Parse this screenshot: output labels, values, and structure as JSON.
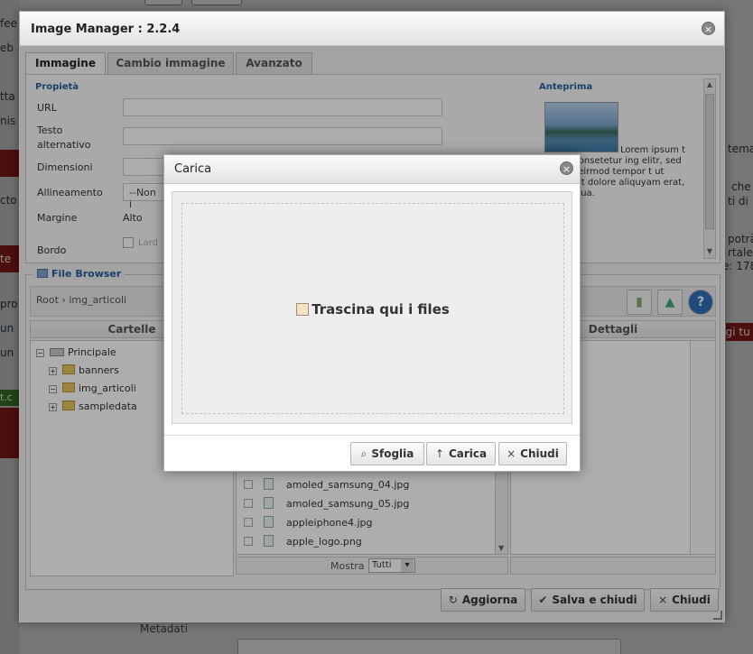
{
  "background": {
    "left_fragments": [
      "fee",
      "eb",
      "tta",
      "nis",
      "cto",
      "te",
      "pro",
      "un",
      "un",
      "t.c"
    ],
    "right_fragments": [
      "tema",
      "che",
      "ti di",
      "potrà",
      "rtale",
      "e: 178",
      "ggi tu"
    ],
    "metadata_label": "Metadati"
  },
  "image_manager": {
    "title": "Image Manager : 2.2.4",
    "tabs": [
      {
        "label": "Immagine",
        "active": true
      },
      {
        "label": "Cambio immagine",
        "active": false
      },
      {
        "label": "Avanzato",
        "active": false
      }
    ],
    "properties": {
      "section_title": "Propietà",
      "url_label": "URL",
      "alt_label_1": "Testo",
      "alt_label_2": "alternativo",
      "dimensions_label": "Dimensioni",
      "alignment_label": "Allineamento",
      "alignment_value": "--Non i",
      "margin_label": "Margine",
      "margin_top_label": "Alto",
      "border_label": "Bordo",
      "border_check_label": "Lard"
    },
    "preview": {
      "section_title": "Anteprima",
      "text": "Lorem ipsum t amet, consetetur ing elitr, sed diam y eirmod tempor t ut labore et dolore aliquyam erat, sed luptua."
    },
    "file_browser": {
      "legend": "File Browser",
      "breadcrumb": "Root › img_articoli",
      "folders_header": "Cartelle",
      "details_header": "Dettagli",
      "tree": [
        {
          "label": "Principale",
          "toggle": "−",
          "root": true
        },
        {
          "label": "banners",
          "toggle": "+"
        },
        {
          "label": "img_articoli",
          "toggle": "−"
        },
        {
          "label": "sampledata",
          "toggle": "+"
        }
      ],
      "files": [
        "amoled_samsung_04.jpg",
        "amoled_samsung_05.jpg",
        "appleiphone4.jpg",
        "apple_logo.png"
      ],
      "show_label": "Mostra",
      "show_value": "Tutti"
    },
    "buttons": {
      "refresh": "Aggiorna",
      "save_close": "Salva e chiudi",
      "close": "Chiudi"
    }
  },
  "upload_dialog": {
    "title": "Carica",
    "drop_text": "Trascina qui i files",
    "buttons": {
      "browse": "Sfoglia",
      "upload": "Carica",
      "close": "Chiudi"
    }
  },
  "icons": {
    "close": "×",
    "browse": "⌕",
    "upload": "↑",
    "help": "?",
    "refresh": "↻",
    "check": "✔",
    "chevron_down": "▾"
  },
  "colors": {
    "section_title": "#2a5d9f",
    "help_button": "#2f6fb8"
  }
}
